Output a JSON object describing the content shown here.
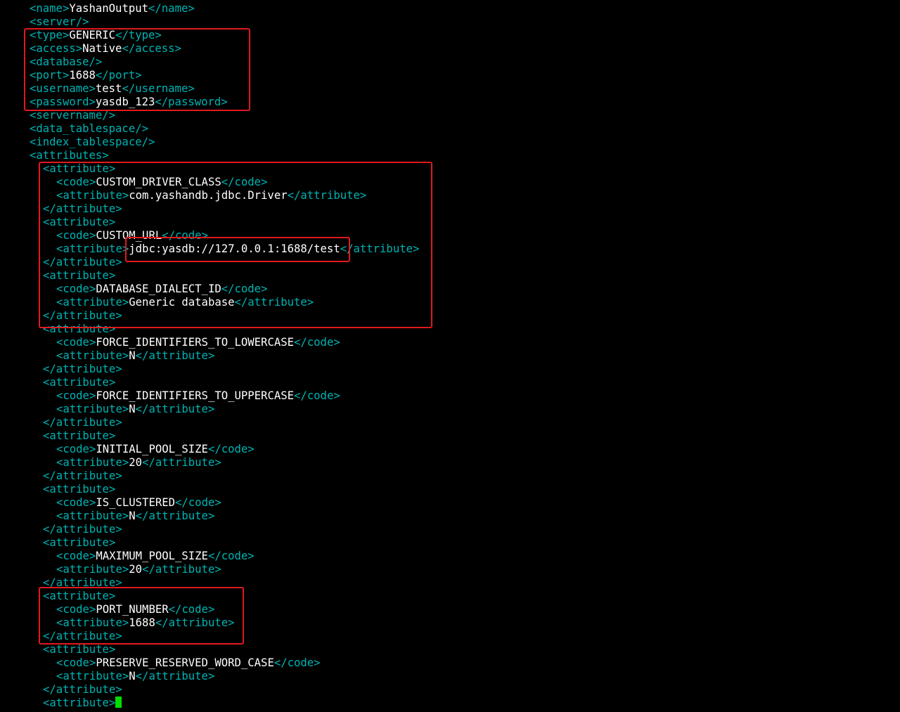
{
  "lines": [
    {
      "indent": 0,
      "segments": [
        {
          "t": "<name>",
          "k": "tag"
        },
        {
          "t": "YashanOutput",
          "k": "val"
        },
        {
          "t": "</name>",
          "k": "tag"
        }
      ]
    },
    {
      "indent": 0,
      "segments": [
        {
          "t": "<server/>",
          "k": "tag"
        }
      ]
    },
    {
      "indent": 0,
      "segments": [
        {
          "t": "<type>",
          "k": "tag"
        },
        {
          "t": "GENERIC",
          "k": "val"
        },
        {
          "t": "</type>",
          "k": "tag"
        }
      ]
    },
    {
      "indent": 0,
      "segments": [
        {
          "t": "<access>",
          "k": "tag"
        },
        {
          "t": "Native",
          "k": "val"
        },
        {
          "t": "</access>",
          "k": "tag"
        }
      ]
    },
    {
      "indent": 0,
      "segments": [
        {
          "t": "<database/>",
          "k": "tag"
        }
      ]
    },
    {
      "indent": 0,
      "segments": [
        {
          "t": "<port>",
          "k": "tag"
        },
        {
          "t": "1688",
          "k": "val"
        },
        {
          "t": "</port>",
          "k": "tag"
        }
      ]
    },
    {
      "indent": 0,
      "segments": [
        {
          "t": "<username>",
          "k": "tag"
        },
        {
          "t": "test",
          "k": "val"
        },
        {
          "t": "</username>",
          "k": "tag"
        }
      ]
    },
    {
      "indent": 0,
      "segments": [
        {
          "t": "<password>",
          "k": "tag"
        },
        {
          "t": "yasdb_123",
          "k": "val"
        },
        {
          "t": "</password>",
          "k": "tag"
        }
      ]
    },
    {
      "indent": 0,
      "segments": [
        {
          "t": "<servername/>",
          "k": "tag"
        }
      ]
    },
    {
      "indent": 0,
      "segments": [
        {
          "t": "<data_tablespace/>",
          "k": "tag"
        }
      ]
    },
    {
      "indent": 0,
      "segments": [
        {
          "t": "<index_tablespace/>",
          "k": "tag"
        }
      ]
    },
    {
      "indent": 0,
      "segments": [
        {
          "t": "<attributes>",
          "k": "tag"
        }
      ]
    },
    {
      "indent": 1,
      "segments": [
        {
          "t": "<attribute>",
          "k": "tag"
        }
      ]
    },
    {
      "indent": 2,
      "segments": [
        {
          "t": "<code>",
          "k": "tag"
        },
        {
          "t": "CUSTOM_DRIVER_CLASS",
          "k": "val"
        },
        {
          "t": "</code>",
          "k": "tag"
        }
      ]
    },
    {
      "indent": 2,
      "segments": [
        {
          "t": "<attribute>",
          "k": "tag"
        },
        {
          "t": "com.yashandb.jdbc.Driver",
          "k": "val"
        },
        {
          "t": "</attribute>",
          "k": "tag"
        }
      ]
    },
    {
      "indent": 1,
      "segments": [
        {
          "t": "</attribute>",
          "k": "tag"
        }
      ]
    },
    {
      "indent": 1,
      "segments": [
        {
          "t": "<attribute>",
          "k": "tag"
        }
      ]
    },
    {
      "indent": 2,
      "segments": [
        {
          "t": "<code>",
          "k": "tag"
        },
        {
          "t": "CUSTOM_URL",
          "k": "val"
        },
        {
          "t": "</code>",
          "k": "tag"
        }
      ]
    },
    {
      "indent": 2,
      "segments": [
        {
          "t": "<attribute>",
          "k": "tag"
        },
        {
          "t": "jdbc:yasdb://127.0.0.1:1688/test",
          "k": "val"
        },
        {
          "t": "</attribute>",
          "k": "tag"
        }
      ]
    },
    {
      "indent": 1,
      "segments": [
        {
          "t": "</attribute>",
          "k": "tag"
        }
      ]
    },
    {
      "indent": 1,
      "segments": [
        {
          "t": "<attribute>",
          "k": "tag"
        }
      ]
    },
    {
      "indent": 2,
      "segments": [
        {
          "t": "<code>",
          "k": "tag"
        },
        {
          "t": "DATABASE_DIALECT_ID",
          "k": "val"
        },
        {
          "t": "</code>",
          "k": "tag"
        }
      ]
    },
    {
      "indent": 2,
      "segments": [
        {
          "t": "<attribute>",
          "k": "tag"
        },
        {
          "t": "Generic database",
          "k": "val"
        },
        {
          "t": "</attribute>",
          "k": "tag"
        }
      ]
    },
    {
      "indent": 1,
      "segments": [
        {
          "t": "</attribute>",
          "k": "tag"
        }
      ]
    },
    {
      "indent": 1,
      "segments": [
        {
          "t": "<attribute>",
          "k": "tag"
        }
      ]
    },
    {
      "indent": 2,
      "segments": [
        {
          "t": "<code>",
          "k": "tag"
        },
        {
          "t": "FORCE_IDENTIFIERS_TO_LOWERCASE",
          "k": "val"
        },
        {
          "t": "</code>",
          "k": "tag"
        }
      ]
    },
    {
      "indent": 2,
      "segments": [
        {
          "t": "<attribute>",
          "k": "tag"
        },
        {
          "t": "N",
          "k": "val"
        },
        {
          "t": "</attribute>",
          "k": "tag"
        }
      ]
    },
    {
      "indent": 1,
      "segments": [
        {
          "t": "</attribute>",
          "k": "tag"
        }
      ]
    },
    {
      "indent": 1,
      "segments": [
        {
          "t": "<attribute>",
          "k": "tag"
        }
      ]
    },
    {
      "indent": 2,
      "segments": [
        {
          "t": "<code>",
          "k": "tag"
        },
        {
          "t": "FORCE_IDENTIFIERS_TO_UPPERCASE",
          "k": "val"
        },
        {
          "t": "</code>",
          "k": "tag"
        }
      ]
    },
    {
      "indent": 2,
      "segments": [
        {
          "t": "<attribute>",
          "k": "tag"
        },
        {
          "t": "N",
          "k": "val"
        },
        {
          "t": "</attribute>",
          "k": "tag"
        }
      ]
    },
    {
      "indent": 1,
      "segments": [
        {
          "t": "</attribute>",
          "k": "tag"
        }
      ]
    },
    {
      "indent": 1,
      "segments": [
        {
          "t": "<attribute>",
          "k": "tag"
        }
      ]
    },
    {
      "indent": 2,
      "segments": [
        {
          "t": "<code>",
          "k": "tag"
        },
        {
          "t": "INITIAL_POOL_SIZE",
          "k": "val"
        },
        {
          "t": "</code>",
          "k": "tag"
        }
      ]
    },
    {
      "indent": 2,
      "segments": [
        {
          "t": "<attribute>",
          "k": "tag"
        },
        {
          "t": "20",
          "k": "val"
        },
        {
          "t": "</attribute>",
          "k": "tag"
        }
      ]
    },
    {
      "indent": 1,
      "segments": [
        {
          "t": "</attribute>",
          "k": "tag"
        }
      ]
    },
    {
      "indent": 1,
      "segments": [
        {
          "t": "<attribute>",
          "k": "tag"
        }
      ]
    },
    {
      "indent": 2,
      "segments": [
        {
          "t": "<code>",
          "k": "tag"
        },
        {
          "t": "IS_CLUSTERED",
          "k": "val"
        },
        {
          "t": "</code>",
          "k": "tag"
        }
      ]
    },
    {
      "indent": 2,
      "segments": [
        {
          "t": "<attribute>",
          "k": "tag"
        },
        {
          "t": "N",
          "k": "val"
        },
        {
          "t": "</attribute>",
          "k": "tag"
        }
      ]
    },
    {
      "indent": 1,
      "segments": [
        {
          "t": "</attribute>",
          "k": "tag"
        }
      ]
    },
    {
      "indent": 1,
      "segments": [
        {
          "t": "<attribute>",
          "k": "tag"
        }
      ]
    },
    {
      "indent": 2,
      "segments": [
        {
          "t": "<code>",
          "k": "tag"
        },
        {
          "t": "MAXIMUM_POOL_SIZE",
          "k": "val"
        },
        {
          "t": "</code>",
          "k": "tag"
        }
      ]
    },
    {
      "indent": 2,
      "segments": [
        {
          "t": "<attribute>",
          "k": "tag"
        },
        {
          "t": "20",
          "k": "val"
        },
        {
          "t": "</attribute>",
          "k": "tag"
        }
      ]
    },
    {
      "indent": 1,
      "segments": [
        {
          "t": "</attribute>",
          "k": "tag"
        }
      ]
    },
    {
      "indent": 1,
      "segments": [
        {
          "t": "<attribute>",
          "k": "tag"
        }
      ]
    },
    {
      "indent": 2,
      "segments": [
        {
          "t": "<code>",
          "k": "tag"
        },
        {
          "t": "PORT_NUMBER",
          "k": "val"
        },
        {
          "t": "</code>",
          "k": "tag"
        }
      ]
    },
    {
      "indent": 2,
      "segments": [
        {
          "t": "<attribute>",
          "k": "tag"
        },
        {
          "t": "1688",
          "k": "val"
        },
        {
          "t": "</attribute>",
          "k": "tag"
        }
      ]
    },
    {
      "indent": 1,
      "segments": [
        {
          "t": "</attribute>",
          "k": "tag"
        }
      ]
    },
    {
      "indent": 1,
      "segments": [
        {
          "t": "<attribute>",
          "k": "tag"
        }
      ]
    },
    {
      "indent": 2,
      "segments": [
        {
          "t": "<code>",
          "k": "tag"
        },
        {
          "t": "PRESERVE_RESERVED_WORD_CASE",
          "k": "val"
        },
        {
          "t": "</code>",
          "k": "tag"
        }
      ]
    },
    {
      "indent": 2,
      "segments": [
        {
          "t": "<attribute>",
          "k": "tag"
        },
        {
          "t": "N",
          "k": "val"
        },
        {
          "t": "</attribute>",
          "k": "tag"
        }
      ]
    },
    {
      "indent": 1,
      "segments": [
        {
          "t": "</attribute>",
          "k": "tag"
        }
      ]
    },
    {
      "indent": 1,
      "segments": [
        {
          "t": "<attribute>",
          "k": "tag"
        }
      ],
      "cursor": true
    }
  ],
  "colors": {
    "background": "#000000",
    "tag": "#00b3b3",
    "value": "#ffffff",
    "highlight_box": "#e0191e",
    "cursor": "#00e000"
  }
}
